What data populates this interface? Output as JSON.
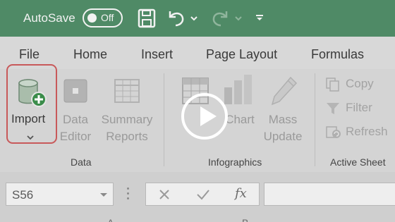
{
  "titlebar": {
    "autosave_label": "AutoSave",
    "toggle_state": "Off",
    "icons": [
      "save-icon",
      "undo-icon",
      "dropdown-caret-icon",
      "redo-icon",
      "dropdown-caret-icon",
      "customize-toolbar-icon"
    ]
  },
  "tabs": [
    "File",
    "Home",
    "Insert",
    "Page Layout",
    "Formulas"
  ],
  "ribbon": {
    "data_group": {
      "label": "Data",
      "import_label": "Import",
      "data_editor": [
        "Data",
        "Editor"
      ],
      "summary_reports": [
        "Summary",
        "Reports"
      ]
    },
    "infographics_group": {
      "label": "Infographics",
      "chart_label": "Chart",
      "mass_update": [
        "Mass",
        "Update"
      ]
    },
    "active_sheet_group": {
      "label": "Active Sheet",
      "copy_label": "Copy",
      "filter_label": "Filter",
      "refresh_label": "Refresh"
    }
  },
  "formula_bar": {
    "name_box_value": "S56",
    "fx_label": "fx"
  },
  "columns": [
    "A",
    "B"
  ],
  "colors": {
    "titlebar": "#4f8a66",
    "import_highlight": "#c8595a",
    "plus_badge": "#3a8c4a"
  }
}
